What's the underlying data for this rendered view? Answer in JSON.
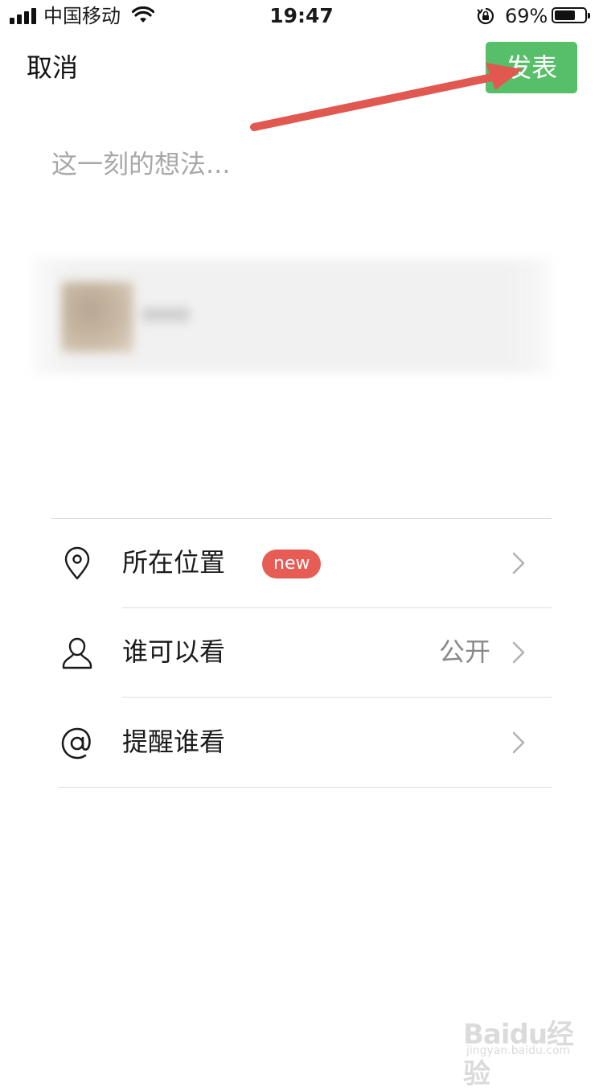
{
  "status_bar": {
    "carrier": "中国移动",
    "time": "19:47",
    "battery_percent": "69%",
    "battery_level": 0.69,
    "icons": [
      "signal-icon",
      "wifi-icon",
      "orientation-lock-icon",
      "battery-icon"
    ]
  },
  "nav": {
    "cancel_label": "取消",
    "publish_label": "发表",
    "publish_color": "#57be6a"
  },
  "compose": {
    "placeholder": "这一刻的想法..."
  },
  "options": [
    {
      "icon": "location-pin-icon",
      "label": "所在位置",
      "badge": "new",
      "value": ""
    },
    {
      "icon": "person-icon",
      "label": "谁可以看",
      "badge": "",
      "value": "公开"
    },
    {
      "icon": "at-sign-icon",
      "label": "提醒谁看",
      "badge": "",
      "value": ""
    }
  ],
  "colors": {
    "badge": "#e75c55",
    "annotation_arrow": "#e0584f"
  },
  "watermark": {
    "logo": "Baidu经验",
    "url": "jingyan.baidu.com"
  }
}
